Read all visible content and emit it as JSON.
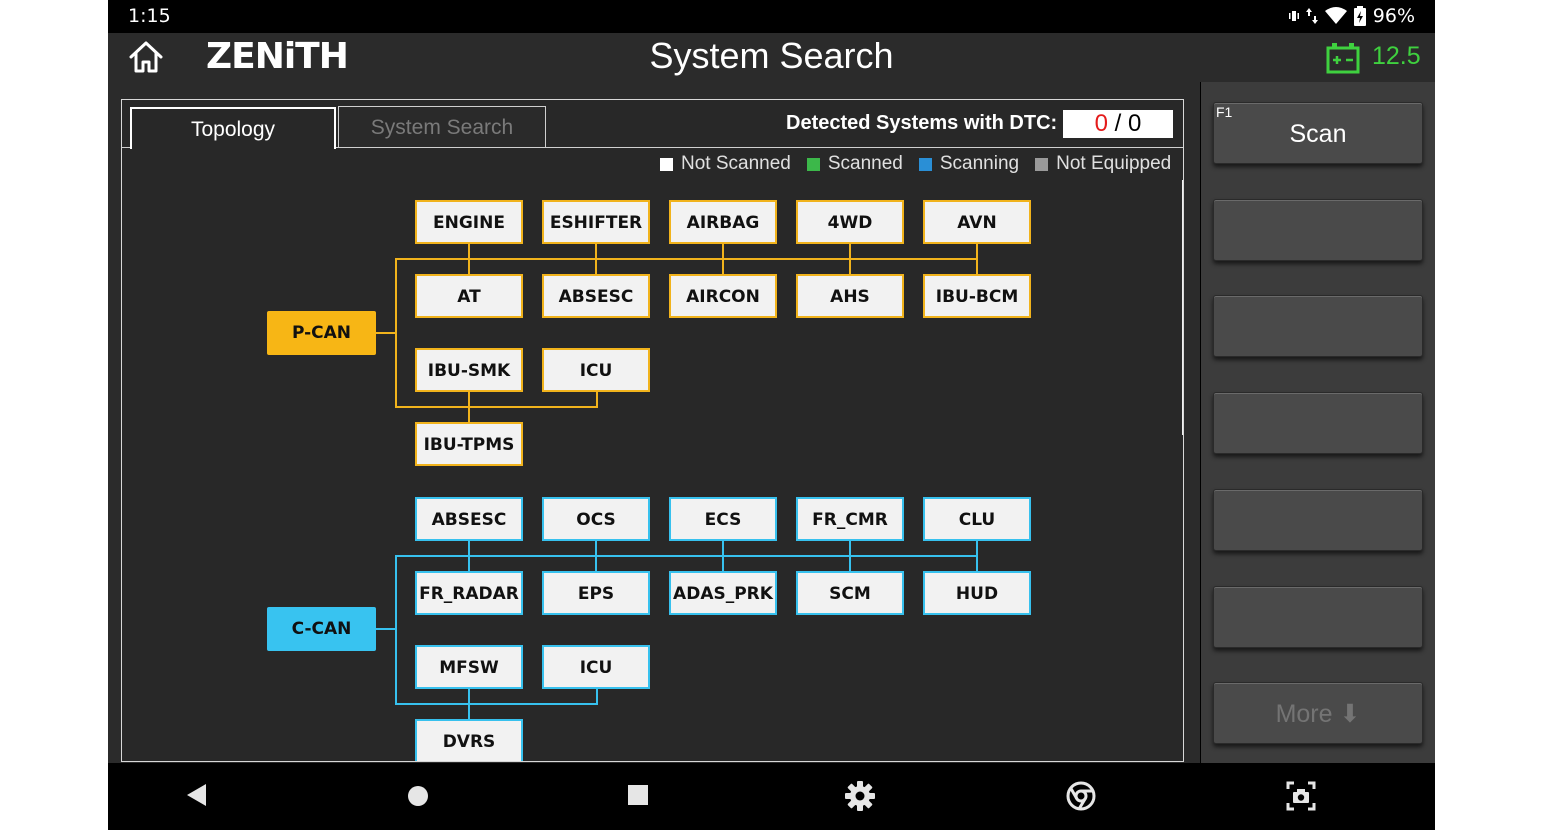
{
  "status_bar": {
    "time": "1:15",
    "battery_percent": "96%"
  },
  "header": {
    "logo": "ZENiTH",
    "title": "System Search",
    "battery_voltage": "12.5"
  },
  "tabs": {
    "topology": "Topology",
    "system_search": "System Search"
  },
  "dtc": {
    "label": "Detected Systems with DTC:",
    "detected": "0",
    "separator": "/",
    "total": "0"
  },
  "legend": [
    {
      "label": "Not Scanned",
      "color": "#ffffff"
    },
    {
      "label": "Scanned",
      "color": "#3cb84a"
    },
    {
      "label": "Scanning",
      "color": "#2a8fd6"
    },
    {
      "label": "Not Equipped",
      "color": "#9a9a9a"
    }
  ],
  "topology": {
    "pcan": {
      "bus": "P-CAN",
      "color": "#f7b615",
      "modules": [
        "ENGINE",
        "ESHIFTER",
        "AIRBAG",
        "4WD",
        "AVN",
        "AT",
        "ABSESC",
        "AIRCON",
        "AHS",
        "IBU-BCM",
        "IBU-SMK",
        "ICU",
        "IBU-TPMS"
      ]
    },
    "ccan": {
      "bus": "C-CAN",
      "color": "#38c3f0",
      "modules": [
        "ABSESC",
        "OCS",
        "ECS",
        "FR_CMR",
        "CLU",
        "FR_RADAR",
        "EPS",
        "ADAS_PRK",
        "SCM",
        "HUD",
        "MFSW",
        "ICU",
        "DVRS"
      ]
    }
  },
  "side_buttons": {
    "f1_tag": "F1",
    "f1_label": "Scan",
    "more_label": "More ⬇"
  }
}
